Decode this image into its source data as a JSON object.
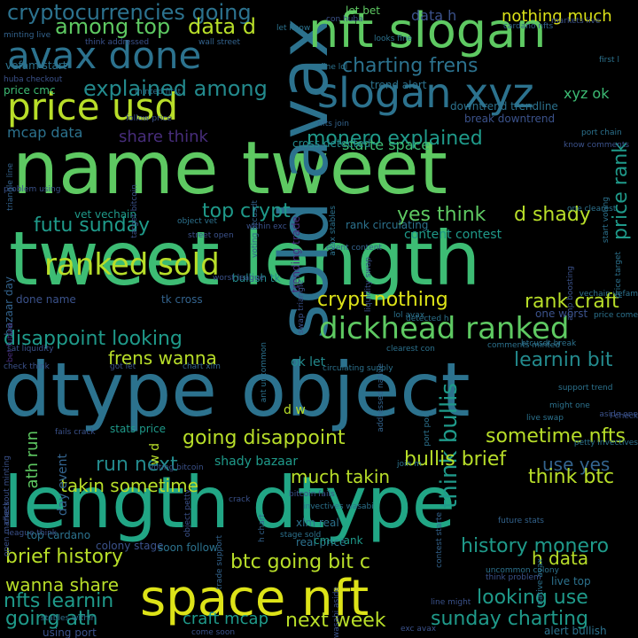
{
  "background": "#000000",
  "palette": {
    "yellow": "#dde318",
    "lime": "#b8de29",
    "green": "#5ec962",
    "mint": "#3dbc74",
    "teal": "#21a685",
    "sea": "#1f9a8a",
    "cyan": "#238a8d",
    "steel": "#2c728e",
    "blue": "#33638d",
    "indigo": "#3b528b",
    "violet": "#472d7b",
    "purple": "#482878",
    "deep": "#440154"
  },
  "words": [
    {
      "text": "name tweet",
      "color": "green",
      "rank": 1
    },
    {
      "text": "tweet length",
      "color": "mint",
      "rank": 1
    },
    {
      "text": "dtype object",
      "color": "steel",
      "rank": 1
    },
    {
      "text": "length dtype",
      "color": "teal",
      "rank": 1
    },
    {
      "text": "sold avax",
      "color": "steel",
      "rank": 2
    },
    {
      "text": "nft slogan",
      "color": "green",
      "rank": 2
    },
    {
      "text": "space nft",
      "color": "yellow",
      "rank": 2
    },
    {
      "text": "slogan xyz",
      "color": "steel",
      "rank": 3
    },
    {
      "text": "avax done",
      "color": "steel",
      "rank": 3
    },
    {
      "text": "price usd",
      "color": "lime",
      "rank": 3
    },
    {
      "text": "ranked sold",
      "color": "lime",
      "rank": 3
    },
    {
      "text": "dickhead ranked",
      "color": "green",
      "rank": 3
    },
    {
      "text": "cryptocurrencies going",
      "color": "steel",
      "rank": 4
    },
    {
      "text": "explained among",
      "color": "cyan",
      "rank": 4
    },
    {
      "text": "among top",
      "color": "green",
      "rank": 4
    },
    {
      "text": "data d",
      "color": "lime",
      "rank": 4
    },
    {
      "text": "charting frens",
      "color": "steel",
      "rank": 4
    },
    {
      "text": "monero explained",
      "color": "sea",
      "rank": 4
    },
    {
      "text": "share think",
      "color": "violet",
      "rank": 5
    },
    {
      "text": "mcap data",
      "color": "steel",
      "rank": 5
    },
    {
      "text": "futu sunday",
      "color": "sea",
      "rank": 4
    },
    {
      "text": "top crypt",
      "color": "sea",
      "rank": 4
    },
    {
      "text": "yes think",
      "color": "green",
      "rank": 4
    },
    {
      "text": "d shady",
      "color": "lime",
      "rank": 4
    },
    {
      "text": "price rank",
      "color": "sea",
      "rank": 4
    },
    {
      "text": "crypt nothing",
      "color": "yellow",
      "rank": 4
    },
    {
      "text": "rank craft",
      "color": "lime",
      "rank": 4
    },
    {
      "text": "disappoint looking",
      "color": "sea",
      "rank": 4
    },
    {
      "text": "frens wanna",
      "color": "lime",
      "rank": 4
    },
    {
      "text": "think bullis",
      "color": "sea",
      "rank": 4
    },
    {
      "text": "learnin bit",
      "color": "cyan",
      "rank": 4
    },
    {
      "text": "going disappoint",
      "color": "lime",
      "rank": 4
    },
    {
      "text": "run next",
      "color": "cyan",
      "rank": 4
    },
    {
      "text": "bullis brief",
      "color": "lime",
      "rank": 4
    },
    {
      "text": "sometime nfts",
      "color": "lime",
      "rank": 4
    },
    {
      "text": "use yes",
      "color": "blue",
      "rank": 4
    },
    {
      "text": "think btc",
      "color": "lime",
      "rank": 4
    },
    {
      "text": "takin sometime",
      "color": "lime",
      "rank": 4
    },
    {
      "text": "much takin",
      "color": "lime",
      "rank": 4
    },
    {
      "text": "brief history",
      "color": "lime",
      "rank": 4
    },
    {
      "text": "btc going bit c",
      "color": "lime",
      "rank": 4
    },
    {
      "text": "history monero",
      "color": "sea",
      "rank": 4
    },
    {
      "text": "h data",
      "color": "lime",
      "rank": 4
    },
    {
      "text": "wanna share",
      "color": "lime",
      "rank": 4
    },
    {
      "text": "nfts learnin",
      "color": "sea",
      "rank": 4
    },
    {
      "text": "going ath",
      "color": "sea",
      "rank": 4
    },
    {
      "text": "looking use",
      "color": "sea",
      "rank": 4
    },
    {
      "text": "next week",
      "color": "lime",
      "rank": 4
    },
    {
      "text": "sunday charting",
      "color": "sea",
      "rank": 4
    },
    {
      "text": "craft mcap",
      "color": "sea",
      "rank": 4
    },
    {
      "text": "ath run",
      "color": "green",
      "rank": 4
    },
    {
      "text": "nothing much",
      "color": "yellow",
      "rank": 5
    },
    {
      "text": "data h",
      "color": "indigo",
      "rank": 5
    },
    {
      "text": "xyz ok",
      "color": "mint",
      "rank": 6
    },
    {
      "text": "starte space",
      "color": "mint",
      "rank": 6
    },
    {
      "text": "ok let",
      "color": "cyan",
      "rank": 6
    },
    {
      "text": "content contest",
      "color": "sea",
      "rank": 6
    },
    {
      "text": "vet vechain",
      "color": "sea",
      "rank": 7
    },
    {
      "text": "bazaar day",
      "color": "blue",
      "rank": 7
    },
    {
      "text": "shady bazaar",
      "color": "sea",
      "rank": 6
    },
    {
      "text": "d w",
      "color": "lime",
      "rank": 6
    },
    {
      "text": "w d",
      "color": "lime",
      "rank": 6
    },
    {
      "text": "day event",
      "color": "blue",
      "rank": 6
    },
    {
      "text": "stats price",
      "color": "sea",
      "rank": 7
    },
    {
      "text": "tk cross",
      "color": "blue",
      "rank": 7
    },
    {
      "text": "bullish tk",
      "color": "cyan",
      "rank": 7
    },
    {
      "text": "cross detected",
      "color": "cyan",
      "rank": 7
    },
    {
      "text": "trend alert",
      "color": "steel",
      "rank": 7
    },
    {
      "text": "downtrend trendline",
      "color": "steel",
      "rank": 7
    },
    {
      "text": "break downtrend",
      "color": "indigo",
      "rank": 7
    },
    {
      "text": "let bet",
      "color": "green",
      "rank": 7
    },
    {
      "text": "price cmc",
      "color": "mint",
      "rank": 7
    },
    {
      "text": "vefam start",
      "color": "steel",
      "rank": 7
    },
    {
      "text": "minting live",
      "color": "blue",
      "rank": 8
    },
    {
      "text": "huba checkout",
      "color": "indigo",
      "rank": 8
    },
    {
      "text": "minted first",
      "color": "steel",
      "rank": 8
    },
    {
      "text": "wall street",
      "color": "blue",
      "rank": 8
    },
    {
      "text": "think addressed",
      "color": "indigo",
      "rank": 8
    },
    {
      "text": "con huba",
      "color": "indigo",
      "rank": 8
    },
    {
      "text": "let know",
      "color": "steel",
      "rank": 8
    },
    {
      "text": "cardano nfts",
      "color": "blue",
      "rank": 8
    },
    {
      "text": "markets live",
      "color": "indigo",
      "rank": 8
    },
    {
      "text": "looks fine",
      "color": "steel",
      "rank": 8
    },
    {
      "text": "fine lol",
      "color": "steel",
      "rank": 8
    },
    {
      "text": "first l",
      "color": "steel",
      "rank": 8
    },
    {
      "text": "nfts join",
      "color": "blue",
      "rank": 8
    },
    {
      "text": "port chain",
      "color": "steel",
      "rank": 8
    },
    {
      "text": "know comments",
      "color": "indigo",
      "rank": 8
    },
    {
      "text": "follow price",
      "color": "indigo",
      "rank": 8
    },
    {
      "text": "problem using",
      "color": "indigo",
      "rank": 8
    },
    {
      "text": "target bitcoin",
      "color": "indigo",
      "rank": 8
    },
    {
      "text": "one clearest",
      "color": "steel",
      "rank": 8
    },
    {
      "text": "price target",
      "color": "steel",
      "rank": 8
    },
    {
      "text": "start voting",
      "color": "steel",
      "rank": 8
    },
    {
      "text": "triangle line",
      "color": "blue",
      "rank": 8
    },
    {
      "text": "voting btcusdt",
      "color": "blue",
      "rank": 8
    },
    {
      "text": "street open",
      "color": "indigo",
      "rank": 8
    },
    {
      "text": "within exc",
      "color": "indigo",
      "rank": 8
    },
    {
      "text": "object vet",
      "color": "steel",
      "rank": 8
    },
    {
      "text": "rank circulating",
      "color": "steel",
      "rank": 8
    },
    {
      "text": "trending trade",
      "color": "violet",
      "rank": 7
    },
    {
      "text": "event content",
      "color": "blue",
      "rank": 7
    },
    {
      "text": "avax stables",
      "color": "steel",
      "rank": 8
    },
    {
      "text": "liquidity swap",
      "color": "indigo",
      "rank": 8
    },
    {
      "text": "amp boosting",
      "color": "indigo",
      "rank": 8
    },
    {
      "text": "price come",
      "color": "steel",
      "rank": 8
    },
    {
      "text": "one worst",
      "color": "indigo",
      "rank": 8
    },
    {
      "text": "btcusdt break",
      "color": "steel",
      "rank": 7
    },
    {
      "text": "comments minted",
      "color": "steel",
      "rank": 8
    },
    {
      "text": "lol avax",
      "color": "steel",
      "rank": 8
    },
    {
      "text": "detected h",
      "color": "steel",
      "rank": 8
    },
    {
      "text": "clearest con",
      "color": "steel",
      "rank": 8
    },
    {
      "text": "addressed native",
      "color": "blue",
      "rank": 8
    },
    {
      "text": "worst league",
      "color": "indigo",
      "rank": 8
    },
    {
      "text": "done name",
      "color": "indigo",
      "rank": 8
    },
    {
      "text": "bet future",
      "color": "violet",
      "rank": 7
    },
    {
      "text": "swap triangle",
      "color": "indigo",
      "rank": 8
    },
    {
      "text": "sat liquidity",
      "color": "indigo",
      "rank": 8
    },
    {
      "text": "check think",
      "color": "indigo",
      "rank": 8
    },
    {
      "text": "got let",
      "color": "indigo",
      "rank": 8
    },
    {
      "text": "chart xlm",
      "color": "blue",
      "rank": 8
    },
    {
      "text": "ant uncommon",
      "color": "steel",
      "rank": 7
    },
    {
      "text": "circulating supply",
      "color": "steel",
      "rank": 8
    },
    {
      "text": "port port",
      "color": "steel",
      "rank": 8
    },
    {
      "text": "support trend",
      "color": "steel",
      "rank": 8
    },
    {
      "text": "might one",
      "color": "steel",
      "rank": 8
    },
    {
      "text": "live swap",
      "color": "steel",
      "rank": 8
    },
    {
      "text": "petty invectives",
      "color": "steel",
      "rank": 8
    },
    {
      "text": "fails crack",
      "color": "indigo",
      "rank": 8
    },
    {
      "text": "open markets",
      "color": "indigo",
      "rank": 8
    },
    {
      "text": "checkout minting",
      "color": "indigo",
      "rank": 8
    },
    {
      "text": "voting bitcoin",
      "color": "indigo",
      "rank": 8
    },
    {
      "text": "join m",
      "color": "steel",
      "rank": 8
    },
    {
      "text": "invectives wasabi",
      "color": "steel",
      "rank": 8
    },
    {
      "text": "xlm real",
      "color": "steel",
      "rank": 8
    },
    {
      "text": "real price",
      "color": "steel",
      "rank": 7
    },
    {
      "text": "cmc rank",
      "color": "sea",
      "rank": 7
    },
    {
      "text": "stage sold",
      "color": "steel",
      "rank": 7
    },
    {
      "text": "h chart",
      "color": "blue",
      "rank": 8
    },
    {
      "text": "trade support",
      "color": "blue",
      "rank": 8
    },
    {
      "text": "object petty",
      "color": "indigo",
      "rank": 8
    },
    {
      "text": "league think",
      "color": "indigo",
      "rank": 8
    },
    {
      "text": "top cardano",
      "color": "steel",
      "rank": 8
    },
    {
      "text": "colony stage",
      "color": "indigo",
      "rank": 7
    },
    {
      "text": "soon follow",
      "color": "steel",
      "rank": 7
    },
    {
      "text": "contest starte",
      "color": "blue",
      "rank": 7
    },
    {
      "text": "uncommon colony",
      "color": "steel",
      "rank": 8
    },
    {
      "text": "native avax",
      "color": "steel",
      "rank": 8
    },
    {
      "text": "think problem",
      "color": "indigo",
      "rank": 8
    },
    {
      "text": "live top",
      "color": "steel",
      "rank": 8
    },
    {
      "text": "future stats",
      "color": "blue",
      "rank": 7
    },
    {
      "text": "stables within",
      "color": "steel",
      "rank": 8
    },
    {
      "text": "wasabi aside",
      "color": "indigo",
      "rank": 8
    },
    {
      "text": "line might",
      "color": "indigo",
      "rank": 8
    },
    {
      "text": "exc avax",
      "color": "indigo",
      "rank": 8
    },
    {
      "text": "using port",
      "color": "indigo",
      "rank": 8
    },
    {
      "text": "come soon",
      "color": "indigo",
      "rank": 8
    },
    {
      "text": "alert bullish",
      "color": "steel",
      "rank": 7
    },
    {
      "text": "bitcoin fails",
      "color": "indigo",
      "rank": 8
    },
    {
      "text": "vechain vefam",
      "color": "steel",
      "rank": 7
    },
    {
      "text": "aside one",
      "color": "indigo",
      "rank": 8
    },
    {
      "text": "l check",
      "color": "indigo",
      "rank": 8
    },
    {
      "text": "crack",
      "color": "indigo",
      "rank": 8
    },
    {
      "text": "sat",
      "color": "indigo",
      "rank": 8
    },
    {
      "text": "m",
      "color": "indigo",
      "rank": 8
    }
  ]
}
